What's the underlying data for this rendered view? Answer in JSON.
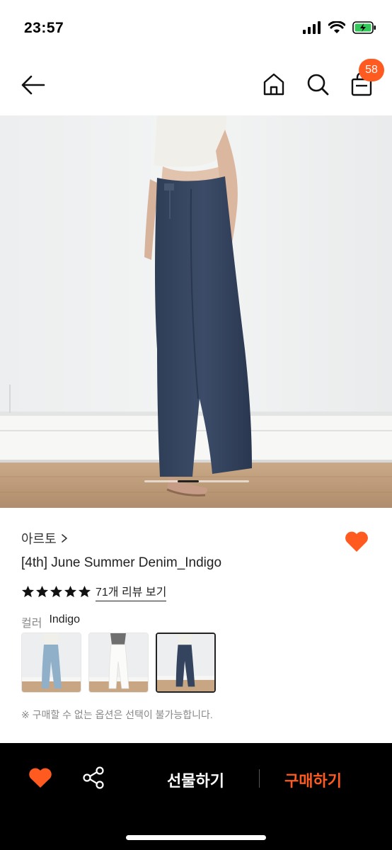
{
  "status_bar": {
    "time": "23:57",
    "icons": [
      "cellular-signal-icon",
      "wifi-icon",
      "battery-charging-icon"
    ]
  },
  "nav": {
    "icons": [
      "back-arrow-icon",
      "home-icon",
      "search-icon",
      "shopping-bag-icon"
    ],
    "cart_count": "58"
  },
  "gallery": {
    "image_description": "model wearing indigo wide denim pants",
    "current_page_fraction": 0.4
  },
  "product": {
    "brand": "아르토",
    "title": "[4th] June Summer Denim_Indigo",
    "rating_stars": 5,
    "review_link": "71개 리뷰 보기",
    "liked": true,
    "color_label": "컬러",
    "color_value": "Indigo",
    "swatches": [
      {
        "name": "light-blue-jeans",
        "selected": false
      },
      {
        "name": "white-jeans",
        "selected": false
      },
      {
        "name": "indigo-jeans",
        "selected": true
      }
    ],
    "notice": "※ 구매할 수 없는 옵션은 선택이 불가능합니다."
  },
  "bottom_bar": {
    "gift_label": "선물하기",
    "buy_label": "구매하기"
  },
  "colors": {
    "accent": "#ff5a1f",
    "bottom_bar_bg": "#000000",
    "text": "#222222"
  }
}
